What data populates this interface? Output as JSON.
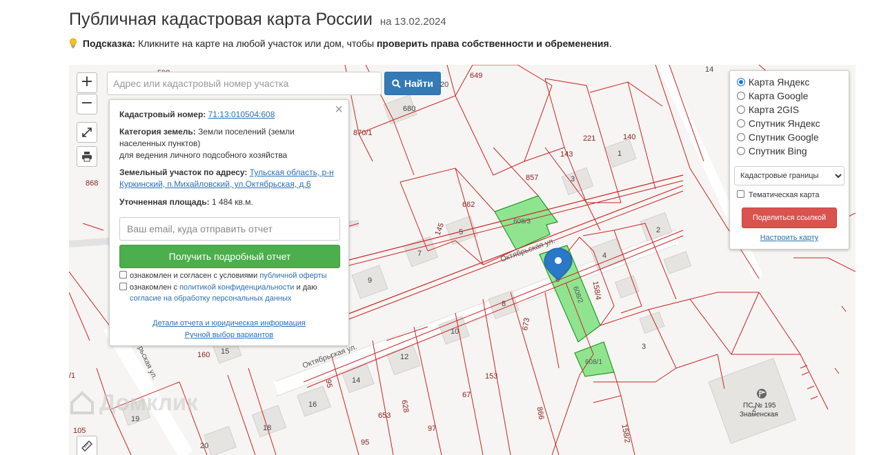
{
  "header": {
    "title": "Публичная кадастровая карта России",
    "date": "на 13.02.2024",
    "hint_label": "Подсказка:",
    "hint_text": "Кликните на карте на любой участок или дом, чтобы",
    "hint_bold": "проверить права собственности и обременения",
    "hint_end": "."
  },
  "map_controls": {
    "zoom_in": "+",
    "zoom_out": "−",
    "search_placeholder": "Адрес или кадастровый номер участка",
    "search_button": "Найти"
  },
  "popup": {
    "close": "×",
    "cad_label": "Кадастровый номер:",
    "cad_value": "71:13:010504:608",
    "category_label": "Категория земель:",
    "category_value_1": "Земли поселений (земли",
    "category_value_2": "населенных пунктов)",
    "category_value_3": "для ведения личного подсобного хозяйства",
    "address_label": "Земельный участок по адресу:",
    "address_value_1": "Тульская область, р-н",
    "address_value_2": "Куркинский, п.Михайловский, ул.Октябрьская, д.6",
    "area_label": "Уточненная площадь:",
    "area_value": "1 484 кв.м.",
    "email_placeholder": "Ваш email, куда отправить отчет",
    "report_button": "Получить подробный отчет",
    "consent1_text": "ознакомлен и согласен с условиями",
    "consent1_link": "публичной оферты",
    "consent2_text": "ознакомлен с",
    "consent2_link": "политикой конфиденциальности",
    "consent2_mid": "и даю",
    "consent2_link2": "согласие на обработку персональных данных",
    "details_link": "Детали отчета и юридическая информация",
    "manual_link": "Ручной выбор вариантов"
  },
  "layers": {
    "options": [
      {
        "label": "Карта Яндекс",
        "selected": true
      },
      {
        "label": "Карта Google",
        "selected": false
      },
      {
        "label": "Карта 2GIS",
        "selected": false
      },
      {
        "label": "Спутник Яндекс",
        "selected": false
      },
      {
        "label": "Спутник Google",
        "selected": false
      },
      {
        "label": "Спутник Bing",
        "selected": false
      }
    ],
    "boundary_select": "Кадастровые границы",
    "thematic": "Тематическая карта",
    "share_button": "Поделиться ссылкой",
    "configure_link": "Настроить карту"
  },
  "map_labels": {
    "street1": "Октябрьская ул.",
    "street2": "Октябрьская ул.",
    "street3": "рьская ул.",
    "parcel_608_3": "608/3",
    "parcel_608_2": "608/2",
    "parcel_608_1": "608/1",
    "building_ps": "ПС № 195",
    "building_ps2": "Знаменская",
    "numbers": [
      "649",
      "14",
      "20",
      "680",
      "870/1",
      "221",
      "140",
      "143",
      "1",
      "857",
      "3",
      "868",
      "662",
      "608/3",
      "2",
      "145",
      "5",
      "7",
      "4",
      "9",
      "158/4",
      "6",
      "8",
      "673",
      "10",
      "3",
      "160",
      "15",
      "12",
      "153",
      "67",
      "14",
      "95",
      "628",
      "16",
      "653",
      "866",
      "19",
      "18",
      "97",
      "95",
      "20",
      "158/2",
      "105",
      "2",
      "/1",
      "598"
    ]
  },
  "watermark": "Домклик",
  "colors": {
    "parcel_line": "#cc2222",
    "parcel_fill": "#7ee07e",
    "search_btn": "#337ab7",
    "report_btn": "#4cae4c",
    "share_btn": "#d9534f",
    "marker": "#2a78c8"
  }
}
